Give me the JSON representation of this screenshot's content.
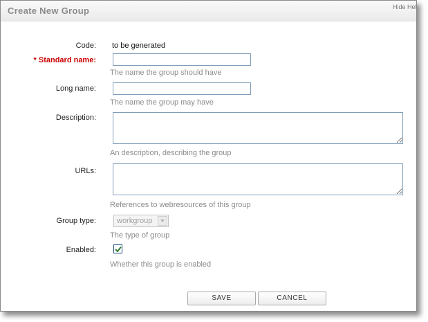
{
  "dialog": {
    "title": "Create New Group",
    "hide_label": "Hide Help"
  },
  "form": {
    "code": {
      "label": "Code:",
      "value": "to be generated"
    },
    "standard_name": {
      "label": "* Standard name:",
      "value": "",
      "hint": "The name the group should have",
      "required": true
    },
    "long_name": {
      "label": "Long name:",
      "value": "",
      "hint": "The name the group may have"
    },
    "description": {
      "label": "Description:",
      "value": "",
      "hint": "An description, describing the group"
    },
    "urls": {
      "label": "URLs:",
      "value": "",
      "hint": "References to webresources of this group"
    },
    "group_type": {
      "label": "Group type:",
      "selected": "workgroup",
      "hint": "The type of group",
      "disabled": true
    },
    "enabled": {
      "label": "Enabled:",
      "checked": true,
      "hint": "Whether this group is enabled"
    }
  },
  "buttons": {
    "save": "SAVE",
    "cancel": "CANCEL"
  },
  "colors": {
    "required_label": "#cc0000",
    "hint_text": "#8c8c8c",
    "title_text": "#8c8c8c",
    "input_border": "#7f9db9",
    "checkmark": "#2e7d32"
  }
}
